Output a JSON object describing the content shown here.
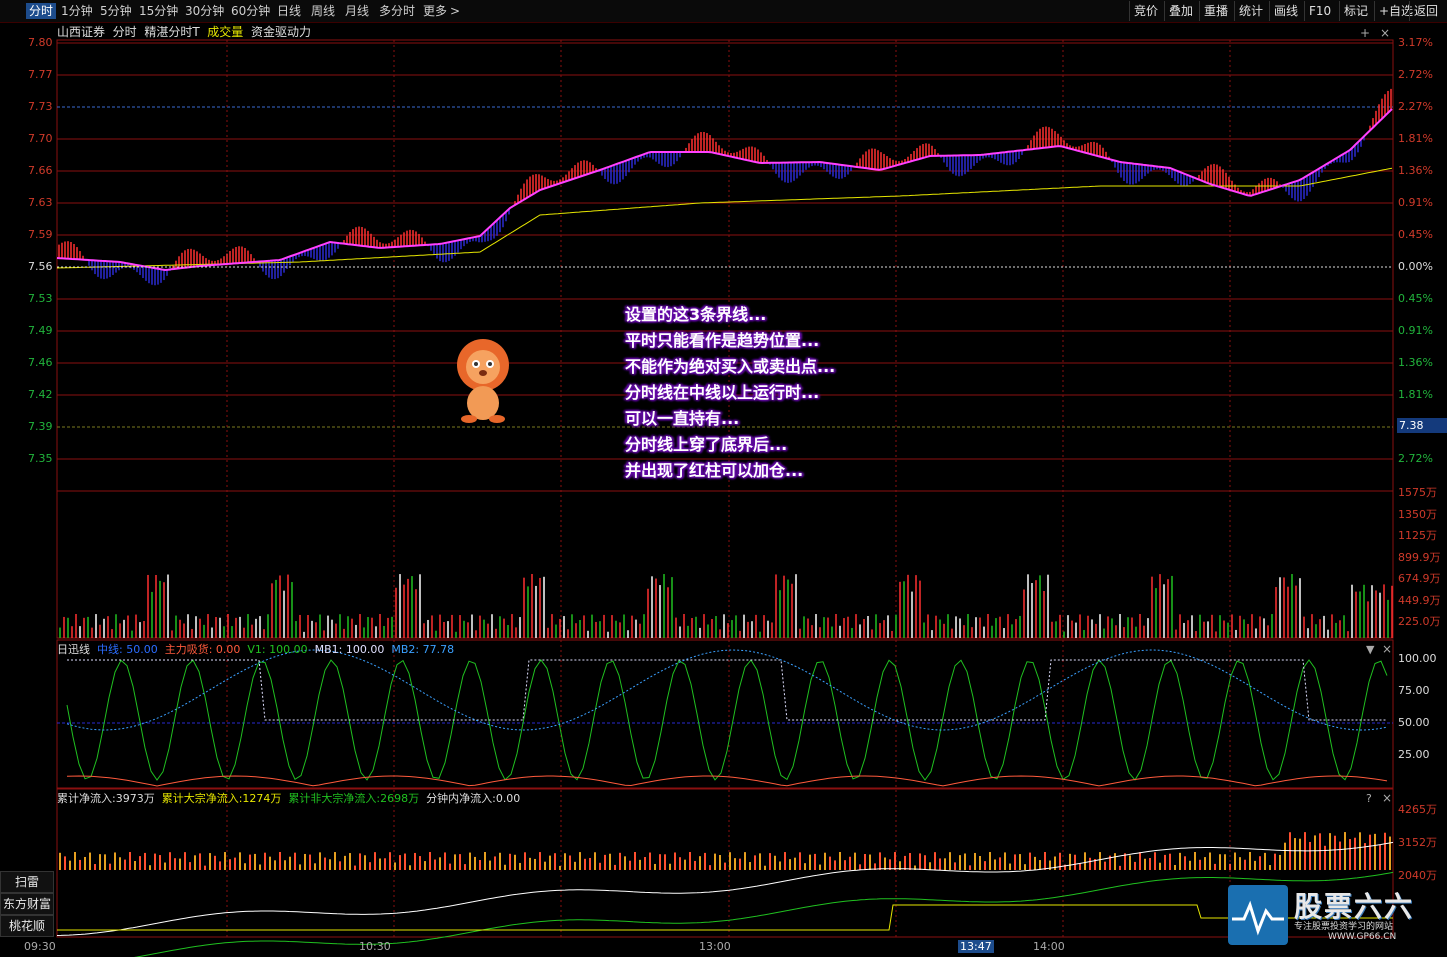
{
  "toolbar": {
    "tabs": [
      "分时",
      "1分钟",
      "5分钟",
      "15分钟",
      "30分钟",
      "60分钟",
      "日线",
      "周线",
      "月线",
      "多分时",
      "更多"
    ],
    "more_arrow": ">",
    "right_buttons": [
      "竞价",
      "叠加",
      "重播",
      "统计",
      "画线",
      "F10",
      "标记",
      "+自选",
      "返回"
    ]
  },
  "subbar": {
    "broker": "山西证券",
    "mode": "分时",
    "indicator": "精湛分时T",
    "volume": "成交量",
    "capital": "资金驱动力"
  },
  "price_axis": {
    "left": [
      "7.80",
      "7.77",
      "7.73",
      "7.70",
      "7.66",
      "7.63",
      "7.59",
      "7.56",
      "7.53",
      "7.49",
      "7.46",
      "7.42",
      "7.39",
      "7.35"
    ],
    "right": [
      "3.17%",
      "2.72%",
      "2.27%",
      "1.81%",
      "1.36%",
      "0.91%",
      "0.45%",
      "0.00%",
      "0.45%",
      "0.91%",
      "1.36%",
      "1.81%",
      "",
      "2.72%"
    ],
    "current_price": "7.38"
  },
  "volume_axis": [
    "1575万",
    "1350万",
    "1125万",
    "899.9万",
    "674.9万",
    "449.9万",
    "225.0万"
  ],
  "annotation": [
    "设置的这3条界线...",
    "平时只能看作是趋势位置...",
    "不能作为绝对买入或卖出点...",
    "分时线在中线以上运行时...",
    "可以一直持有...",
    "分时线上穿了底界后...",
    "并出现了红柱可以加仓..."
  ],
  "rixun": {
    "title": "日迅线",
    "zhongxian": "中线: 50.00",
    "zhuli": "主力吸货: 0.00",
    "v1": "V1: 100.00",
    "mb1": "MB1: 100.00",
    "mb2": "MB2: 77.78",
    "axis": [
      "100.00",
      "75.00",
      "50.00",
      "25.00"
    ]
  },
  "flow": {
    "total": "累计净流入:3973万",
    "block": "累计大宗净流入:1274万",
    "nonblock": "累计非大宗净流入:2698万",
    "minute": "分钟内净流入:0.00",
    "axis": [
      "4265万",
      "3152万",
      "2040万"
    ]
  },
  "left_buttons": [
    "扫雷",
    "东方财富",
    "桃花顺"
  ],
  "time_axis": [
    "09:30",
    "10:30",
    "13:00",
    "13:47",
    "14:00"
  ],
  "icons": {
    "dropdown": "▼",
    "close": "×",
    "help": "?",
    "add": "+"
  },
  "watermark": {
    "brand": "股票六六",
    "tagline": "专注股票投资学习的网站",
    "url": "WWW.GP66.CN"
  },
  "colors": {
    "grid": "#8a1010",
    "up": "#ff3030",
    "down": "#2a2ad0",
    "price_line": "#ff40ff",
    "avg_line": "#e6e600",
    "green": "#20c020",
    "blue": "#2060ff",
    "white": "#ffffff"
  }
}
